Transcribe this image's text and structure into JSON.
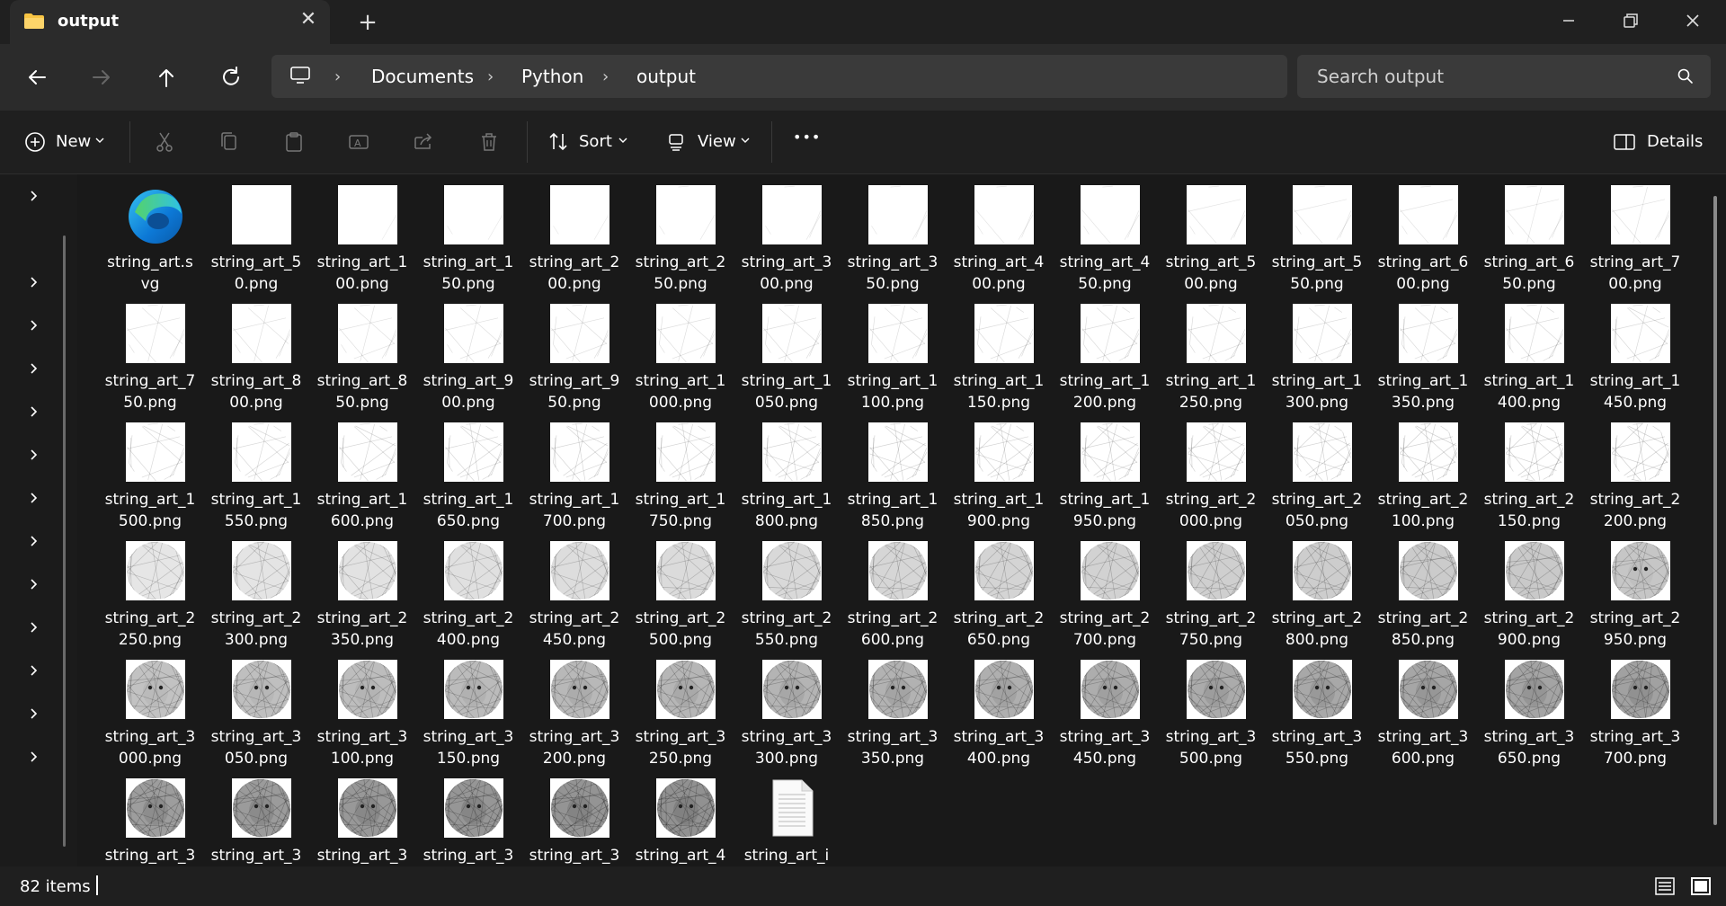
{
  "window": {
    "tab_title": "output",
    "tab_close_icon": "close-icon",
    "new_tab_icon": "plus-icon"
  },
  "nav": {
    "back": "back-arrow-icon",
    "forward": "forward-arrow-icon",
    "up": "up-arrow-icon",
    "refresh": "refresh-icon"
  },
  "breadcrumb": [
    "Documents",
    "Python",
    "output"
  ],
  "search": {
    "placeholder": "Search output"
  },
  "toolbar": {
    "new_label": "New",
    "sort_label": "Sort",
    "view_label": "View",
    "more_label": "•••",
    "details_label": "Details"
  },
  "files": [
    {
      "name": "string_art.s\nvg",
      "type": "svg"
    },
    {
      "name": "string_art_5\n0.png",
      "type": "png",
      "level": 0.0
    },
    {
      "name": "string_art_1\n00.png",
      "type": "png",
      "level": 0.02
    },
    {
      "name": "string_art_1\n50.png",
      "type": "png",
      "level": 0.04
    },
    {
      "name": "string_art_2\n00.png",
      "type": "png",
      "level": 0.06
    },
    {
      "name": "string_art_2\n50.png",
      "type": "png",
      "level": 0.08
    },
    {
      "name": "string_art_3\n00.png",
      "type": "png",
      "level": 0.1
    },
    {
      "name": "string_art_3\n50.png",
      "type": "png",
      "level": 0.11
    },
    {
      "name": "string_art_4\n00.png",
      "type": "png",
      "level": 0.12
    },
    {
      "name": "string_art_4\n50.png",
      "type": "png",
      "level": 0.13
    },
    {
      "name": "string_art_5\n00.png",
      "type": "png",
      "level": 0.14
    },
    {
      "name": "string_art_5\n50.png",
      "type": "png",
      "level": 0.15
    },
    {
      "name": "string_art_6\n00.png",
      "type": "png",
      "level": 0.16
    },
    {
      "name": "string_art_6\n50.png",
      "type": "png",
      "level": 0.17
    },
    {
      "name": "string_art_7\n00.png",
      "type": "png",
      "level": 0.18
    },
    {
      "name": "string_art_7\n50.png",
      "type": "png",
      "level": 0.2
    },
    {
      "name": "string_art_8\n00.png",
      "type": "png",
      "level": 0.21
    },
    {
      "name": "string_art_8\n50.png",
      "type": "png",
      "level": 0.22
    },
    {
      "name": "string_art_9\n00.png",
      "type": "png",
      "level": 0.23
    },
    {
      "name": "string_art_9\n50.png",
      "type": "png",
      "level": 0.24
    },
    {
      "name": "string_art_1\n000.png",
      "type": "png",
      "level": 0.25
    },
    {
      "name": "string_art_1\n050.png",
      "type": "png",
      "level": 0.26
    },
    {
      "name": "string_art_1\n100.png",
      "type": "png",
      "level": 0.27
    },
    {
      "name": "string_art_1\n150.png",
      "type": "png",
      "level": 0.28
    },
    {
      "name": "string_art_1\n200.png",
      "type": "png",
      "level": 0.29
    },
    {
      "name": "string_art_1\n250.png",
      "type": "png",
      "level": 0.3
    },
    {
      "name": "string_art_1\n300.png",
      "type": "png",
      "level": 0.31
    },
    {
      "name": "string_art_1\n350.png",
      "type": "png",
      "level": 0.32
    },
    {
      "name": "string_art_1\n400.png",
      "type": "png",
      "level": 0.33
    },
    {
      "name": "string_art_1\n450.png",
      "type": "png",
      "level": 0.34
    },
    {
      "name": "string_art_1\n500.png",
      "type": "png",
      "level": 0.36
    },
    {
      "name": "string_art_1\n550.png",
      "type": "png",
      "level": 0.37
    },
    {
      "name": "string_art_1\n600.png",
      "type": "png",
      "level": 0.38
    },
    {
      "name": "string_art_1\n650.png",
      "type": "png",
      "level": 0.39
    },
    {
      "name": "string_art_1\n700.png",
      "type": "png",
      "level": 0.4
    },
    {
      "name": "string_art_1\n750.png",
      "type": "png",
      "level": 0.41
    },
    {
      "name": "string_art_1\n800.png",
      "type": "png",
      "level": 0.42
    },
    {
      "name": "string_art_1\n850.png",
      "type": "png",
      "level": 0.43
    },
    {
      "name": "string_art_1\n900.png",
      "type": "png",
      "level": 0.44
    },
    {
      "name": "string_art_1\n950.png",
      "type": "png",
      "level": 0.45
    },
    {
      "name": "string_art_2\n000.png",
      "type": "png",
      "level": 0.46
    },
    {
      "name": "string_art_2\n050.png",
      "type": "png",
      "level": 0.47
    },
    {
      "name": "string_art_2\n100.png",
      "type": "png",
      "level": 0.48
    },
    {
      "name": "string_art_2\n150.png",
      "type": "png",
      "level": 0.49
    },
    {
      "name": "string_art_2\n200.png",
      "type": "png",
      "level": 0.5
    },
    {
      "name": "string_art_2\n250.png",
      "type": "png",
      "level": 0.52
    },
    {
      "name": "string_art_2\n300.png",
      "type": "png",
      "level": 0.53
    },
    {
      "name": "string_art_2\n350.png",
      "type": "png",
      "level": 0.54
    },
    {
      "name": "string_art_2\n400.png",
      "type": "png",
      "level": 0.55
    },
    {
      "name": "string_art_2\n450.png",
      "type": "png",
      "level": 0.56
    },
    {
      "name": "string_art_2\n500.png",
      "type": "png",
      "level": 0.57
    },
    {
      "name": "string_art_2\n550.png",
      "type": "png",
      "level": 0.58
    },
    {
      "name": "string_art_2\n600.png",
      "type": "png",
      "level": 0.59
    },
    {
      "name": "string_art_2\n650.png",
      "type": "png",
      "level": 0.6
    },
    {
      "name": "string_art_2\n700.png",
      "type": "png",
      "level": 0.61
    },
    {
      "name": "string_art_2\n750.png",
      "type": "png",
      "level": 0.62
    },
    {
      "name": "string_art_2\n800.png",
      "type": "png",
      "level": 0.63
    },
    {
      "name": "string_art_2\n850.png",
      "type": "png",
      "level": 0.64
    },
    {
      "name": "string_art_2\n900.png",
      "type": "png",
      "level": 0.65
    },
    {
      "name": "string_art_2\n950.png",
      "type": "png",
      "level": 0.66
    },
    {
      "name": "string_art_3\n000.png",
      "type": "png",
      "level": 0.68
    },
    {
      "name": "string_art_3\n050.png",
      "type": "png",
      "level": 0.69
    },
    {
      "name": "string_art_3\n100.png",
      "type": "png",
      "level": 0.7
    },
    {
      "name": "string_art_3\n150.png",
      "type": "png",
      "level": 0.71
    },
    {
      "name": "string_art_3\n200.png",
      "type": "png",
      "level": 0.72
    },
    {
      "name": "string_art_3\n250.png",
      "type": "png",
      "level": 0.73
    },
    {
      "name": "string_art_3\n300.png",
      "type": "png",
      "level": 0.74
    },
    {
      "name": "string_art_3\n350.png",
      "type": "png",
      "level": 0.75
    },
    {
      "name": "string_art_3\n400.png",
      "type": "png",
      "level": 0.76
    },
    {
      "name": "string_art_3\n450.png",
      "type": "png",
      "level": 0.77
    },
    {
      "name": "string_art_3\n500.png",
      "type": "png",
      "level": 0.78
    },
    {
      "name": "string_art_3\n550.png",
      "type": "png",
      "level": 0.79
    },
    {
      "name": "string_art_3\n600.png",
      "type": "png",
      "level": 0.8
    },
    {
      "name": "string_art_3\n650.png",
      "type": "png",
      "level": 0.81
    },
    {
      "name": "string_art_3\n700.png",
      "type": "png",
      "level": 0.82
    },
    {
      "name": "string_art_3",
      "type": "png",
      "level": 0.84
    },
    {
      "name": "string_art_3",
      "type": "png",
      "level": 0.85
    },
    {
      "name": "string_art_3",
      "type": "png",
      "level": 0.86
    },
    {
      "name": "string_art_3",
      "type": "png",
      "level": 0.87
    },
    {
      "name": "string_art_3",
      "type": "png",
      "level": 0.88
    },
    {
      "name": "string_art_4",
      "type": "png",
      "level": 0.89
    },
    {
      "name": "string_art_i",
      "type": "txt"
    }
  ],
  "status": {
    "item_count": "82 items"
  },
  "colors": {
    "background": "#191919",
    "toolbar": "#1f1f1f",
    "address": "#2b2b2b",
    "accent": "#0078d4"
  }
}
